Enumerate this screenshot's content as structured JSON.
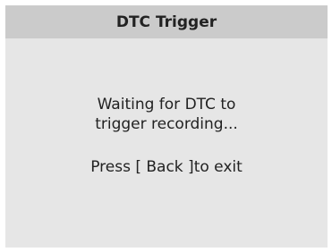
{
  "window": {
    "title": "DTC Trigger"
  },
  "main": {
    "message_line1": "Waiting for DTC to",
    "message_line2": "trigger recording...",
    "hint": "Press [ Back ]to exit"
  },
  "colors": {
    "title_bar_bg": "#cbcbcb",
    "content_bg": "#e6e6e6",
    "text": "#222222"
  }
}
